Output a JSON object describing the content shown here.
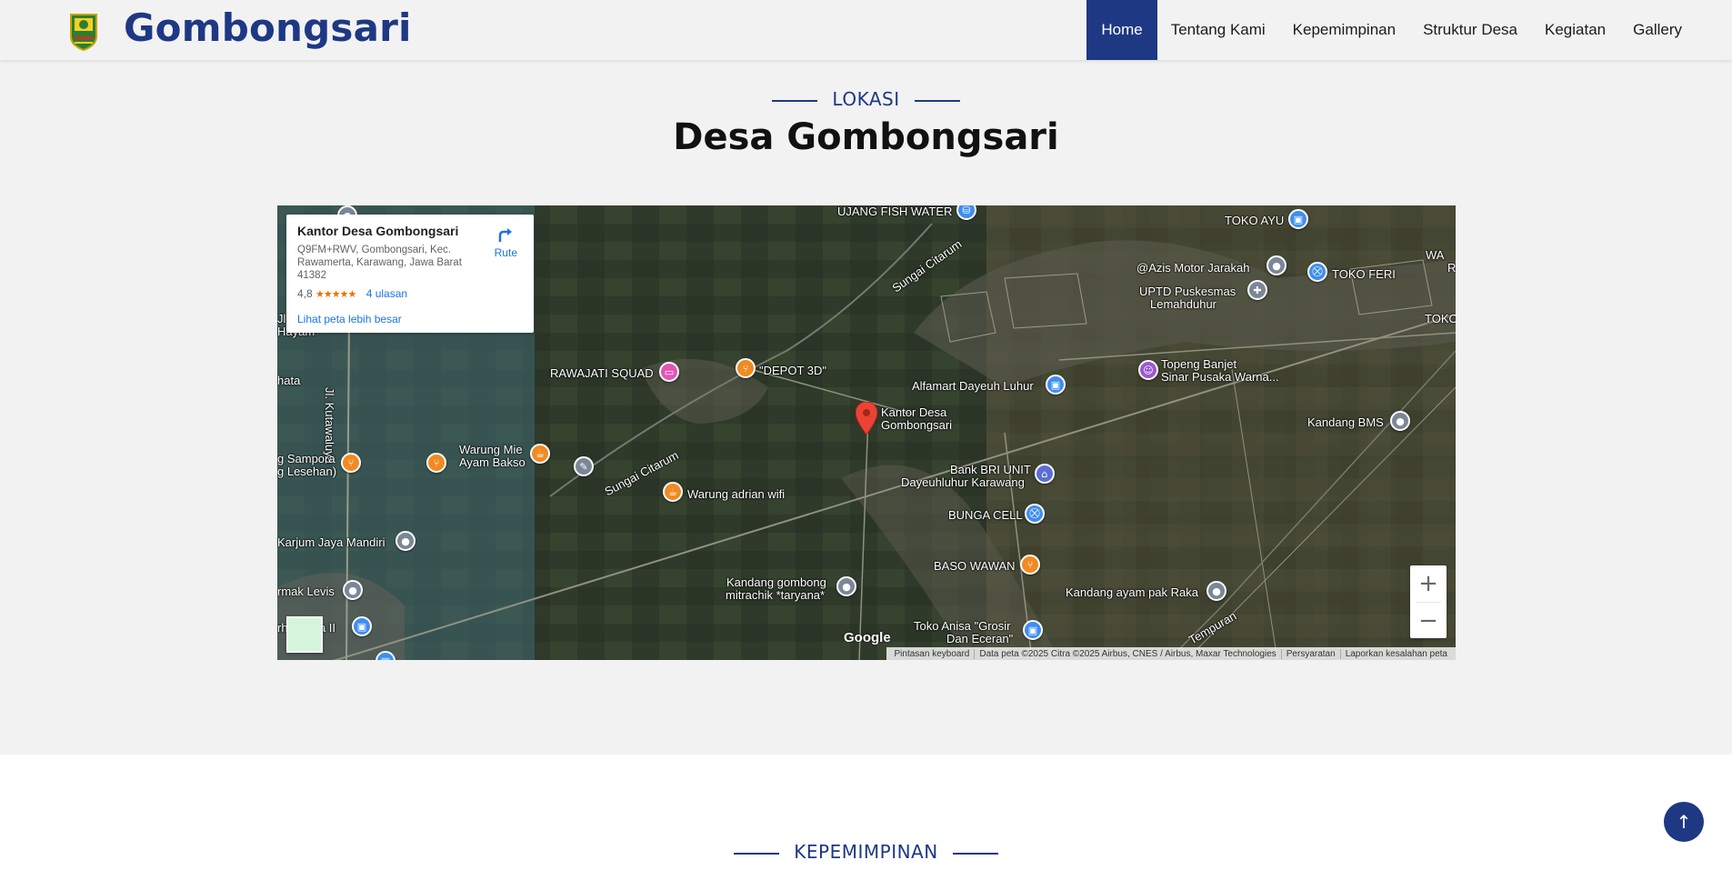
{
  "header": {
    "brand": "Gombongsari",
    "nav": [
      "Home",
      "Tentang Kami",
      "Kepemimpinan",
      "Struktur Desa",
      "Kegiatan",
      "Gallery"
    ],
    "active_nav": "Home"
  },
  "location": {
    "eyebrow": "LOKASI",
    "title": "Desa Gombongsari"
  },
  "map": {
    "infocard": {
      "name": "Kantor Desa Gombongsari",
      "address": "Q9FM+RWV, Gombongsari, Kec. Rawamerta, Karawang, Jawa Barat 41382",
      "rating": "4,8",
      "stars": "★★★★★",
      "reviews": "4 ulasan",
      "route": "Rute",
      "bigger_map": "Lihat peta lebih besar"
    },
    "places": {
      "p1": "UJANG FISH WATER",
      "p2": "TOKO AYU",
      "p3": "@Azis Motor Jarakah",
      "p4": "TOKO FERI",
      "p5": "UPTD Puskesmas",
      "p5b": "Lemahduhur",
      "p6": "TOKO",
      "p7": "RAWAJATI SQUAD",
      "p8": "\"DEPOT 3D\"",
      "p9": "Topeng Banjet",
      "p9b": "Sinar Pusaka Warna...",
      "p10": "Alfamart Dayeuh Luhur",
      "p11": "Kantor Desa",
      "p11b": "Gombongsari",
      "p12": "Kandang BMS",
      "p13": "hata",
      "p14": "Warung Mie",
      "p14b": "Ayam Bakso",
      "p15": "g Sampora",
      "p15b": "g Lesehan)",
      "p16": "Bank BRI UNIT",
      "p16b": "Dayeuhluhur Karawang",
      "p17": "Warung adrian wifi",
      "p18": "BUNGA CELL",
      "p19": "Karjum Jaya Mandiri",
      "p20": "BASO WAWAN",
      "p21": "rmak Levis",
      "p22": "Kandang gombong",
      "p22b": "mitrachik *taryana*",
      "p23": "Kandang ayam pak Raka",
      "p24": "Toko Anisa \"Grosir",
      "p24b": "Dan Eceran\"",
      "p25": "rh",
      "p25b": "tra II",
      "p26": "WA",
      "p26b": "R",
      "road1": "Sungai Citarum",
      "road2": "Sungai Citarum",
      "road3": "Jl. Kutawaluya",
      "road4": "Tempuran",
      "p27": "Jl.",
      "p28": "Hayam"
    },
    "google": "Google",
    "zoom_in": "+",
    "zoom_out": "−",
    "attribution": [
      "Pintasan keyboard",
      "Data peta ©2025 Citra ©2025 Airbus, CNES / Airbus, Maxar Technologies",
      "Persyaratan",
      "Laporkan kesalahan peta"
    ]
  },
  "leadership": {
    "eyebrow": "KEPEMIMPINAN"
  },
  "to_top": "↑"
}
